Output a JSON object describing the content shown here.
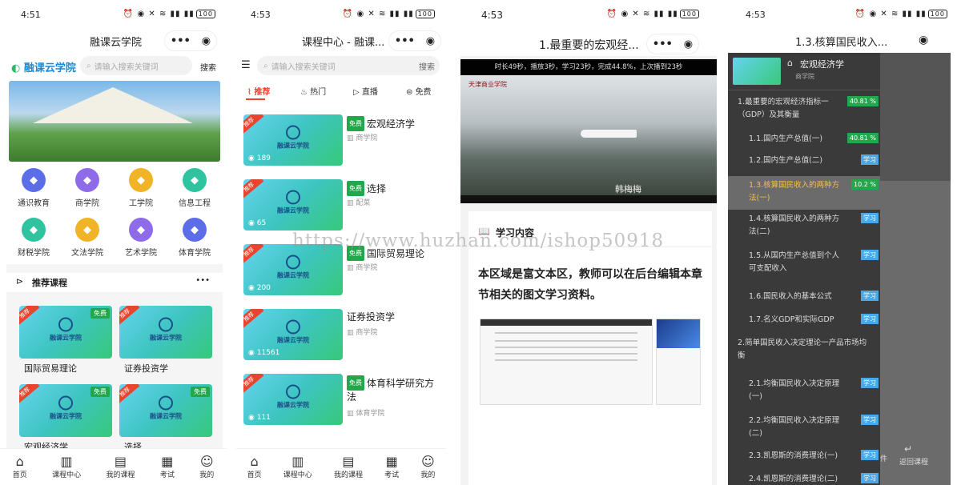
{
  "watermark": "https://www.huzhan.com/ishop50918",
  "screen1": {
    "time": "4:51",
    "title": "融课云学院",
    "brand": "融课云学院",
    "search_placeholder": "请输入搜索关键词",
    "search_btn": "搜索",
    "categories": [
      {
        "label": "通识教育",
        "color": "#5b6ee8"
      },
      {
        "label": "商学院",
        "color": "#8e6be8"
      },
      {
        "label": "工学院",
        "color": "#f2b427"
      },
      {
        "label": "信息工程",
        "color": "#2fc3a0"
      },
      {
        "label": "财税学院",
        "color": "#2fc3a0"
      },
      {
        "label": "文法学院",
        "color": "#f2b427"
      },
      {
        "label": "艺术学院",
        "color": "#8e6be8"
      },
      {
        "label": "体育学院",
        "color": "#5b6ee8"
      }
    ],
    "section": "推荐课程",
    "more": "•••",
    "courses": [
      {
        "title": "国际贸易理论",
        "badge": "推荐",
        "free": "免费"
      },
      {
        "title": "证券投资学",
        "badge": "推荐",
        "free": ""
      },
      {
        "title": "宏观经济学",
        "badge": "推荐",
        "free": "免费"
      },
      {
        "title": "选择",
        "badge": "推荐",
        "free": "免费"
      }
    ],
    "logo_text": "融课云学院",
    "nav": [
      "首页",
      "课程中心",
      "我的课程",
      "考试",
      "我的"
    ]
  },
  "screen2": {
    "time": "4:53",
    "title": "课程中心 - 融课...",
    "search_placeholder": "请输入搜索关键词",
    "search_btn": "搜索",
    "tabs": [
      "推荐",
      "热门",
      "直播",
      "免费"
    ],
    "courses": [
      {
        "title": "宏观经济学",
        "sub": "商学院",
        "views": "189",
        "free": "免费"
      },
      {
        "title": "选择",
        "sub": "配菜",
        "views": "65",
        "free": "免费"
      },
      {
        "title": "国际贸易理论",
        "sub": "商学院",
        "views": "200",
        "free": "免费"
      },
      {
        "title": "证券投资学",
        "sub": "商学院",
        "views": "11561",
        "free": ""
      },
      {
        "title": "体育科学研究方法",
        "sub": "体育学院",
        "views": "111",
        "free": "免费"
      }
    ],
    "badge": "推荐",
    "logo_text": "融课云学院",
    "nav": [
      "首页",
      "课程中心",
      "我的课程",
      "考试",
      "我的"
    ]
  },
  "screen3": {
    "time": "4:53",
    "title": "1.最重要的宏观经...",
    "video_info": "时长49秒，播放3秒，学习23秒，完成44.8%，上次播到23秒",
    "school": "天津商业学院",
    "caption": "韩梅梅",
    "section": "学习内容",
    "rich_text": "本区域是富文本区，教师可以在后台编辑本章节相关的图文学习资料。"
  },
  "screen4": {
    "time": "4:53",
    "title": "1.3.核算国民收入...",
    "course": "宏观经济学",
    "college": "商学院",
    "chapters": [
      {
        "text": "1.最重要的宏观经济指标一（GDP）及其衡量",
        "pct": "40.81 %",
        "study": "",
        "indent": false,
        "active": false
      },
      {
        "text": "1.1.国内生产总值(一)",
        "pct": "40.81 %",
        "study": "",
        "indent": true,
        "active": false
      },
      {
        "text": "1.2.国内生产总值(二)",
        "pct": "",
        "study": "学习",
        "indent": true,
        "active": false
      },
      {
        "text": "1.3.核算国民收入的两种方法(一)",
        "pct": "10.2 %",
        "study": "",
        "indent": true,
        "active": true
      },
      {
        "text": "1.4.核算国民收入的两种方法(二)",
        "pct": "",
        "study": "学习",
        "indent": true,
        "active": false
      },
      {
        "text": "1.5.从国内生产总值到个人可支配收入",
        "pct": "",
        "study": "学习",
        "indent": true,
        "active": false
      },
      {
        "text": "1.6.国民收入的基本公式",
        "pct": "",
        "study": "学习",
        "indent": true,
        "active": false
      },
      {
        "text": "1.7.名义GDP和实际GDP",
        "pct": "",
        "study": "学习",
        "indent": true,
        "active": false
      },
      {
        "text": "2.简单国民收入决定理论一产品市场均衡",
        "pct": "",
        "study": "",
        "indent": false,
        "active": false
      },
      {
        "text": "2.1.均衡国民收入决定原理(一)",
        "pct": "",
        "study": "学习",
        "indent": true,
        "active": false
      },
      {
        "text": "2.2.均衡国民收入决定原理(二)",
        "pct": "",
        "study": "学习",
        "indent": true,
        "active": false
      },
      {
        "text": "2.3.凯恩斯的消费理论(一)",
        "pct": "",
        "study": "学习",
        "indent": true,
        "active": false
      },
      {
        "text": "2.4.凯恩斯的消费理论(二)",
        "pct": "",
        "study": "学习",
        "indent": true,
        "active": false
      }
    ],
    "right_items": [
      "件",
      "返回课程"
    ]
  }
}
